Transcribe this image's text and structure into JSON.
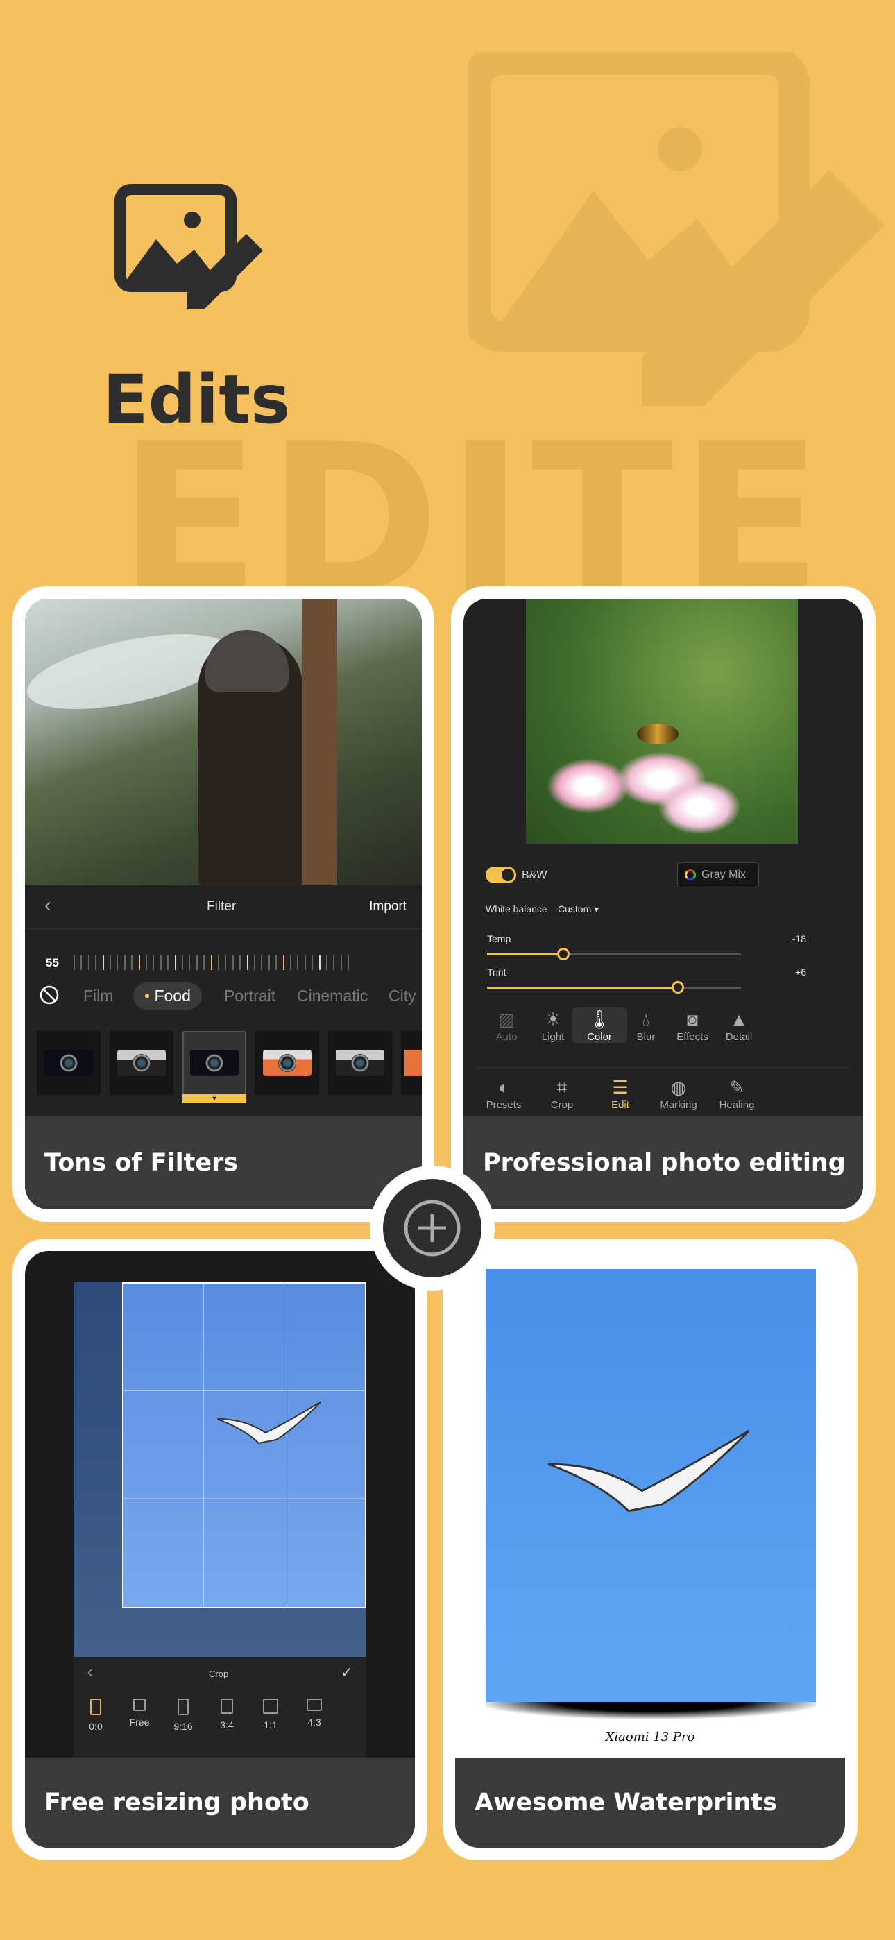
{
  "header": {
    "title": "Edits",
    "watermark_word": "EDITE",
    "icon": "image-edit-icon"
  },
  "colors": {
    "background": "#F5C15E",
    "accent": "#F3C14E",
    "card_caption": "#3a3a3a"
  },
  "cards": [
    {
      "caption": "Tons of Filters",
      "filter": {
        "back": "‹",
        "title": "Filter",
        "import": "Import",
        "value": "55",
        "categories": [
          "Film",
          "Food",
          "Portrait",
          "Cinematic",
          "City"
        ],
        "selected_category": "Food",
        "selected_thumb_index": 2
      }
    },
    {
      "caption": "Professional photo editing",
      "edit": {
        "bw_label": "B&W",
        "bw_on": true,
        "gray_mix": "Gray Mix",
        "white_balance": "White balance",
        "wb_mode": "Custom",
        "sliders": [
          {
            "label": "Temp",
            "value": "-18",
            "fraction": 0.3
          },
          {
            "label": "Trint",
            "value": "+6",
            "fraction": 0.75
          }
        ],
        "tools": [
          {
            "label": "Auto",
            "icon": "auto-image-icon"
          },
          {
            "label": "Light",
            "icon": "sun-icon"
          },
          {
            "label": "Color",
            "icon": "thermometer-icon"
          },
          {
            "label": "Blur",
            "icon": "drop-icon"
          },
          {
            "label": "Effects",
            "icon": "effects-icon"
          },
          {
            "label": "Detail",
            "icon": "triangle-icon"
          }
        ],
        "selected_tool": "Color",
        "tabs": [
          {
            "label": "Presets",
            "icon": "presets-icon"
          },
          {
            "label": "Crop",
            "icon": "crop-icon"
          },
          {
            "label": "Edit",
            "icon": "sliders-icon"
          },
          {
            "label": "Marking",
            "icon": "marking-icon"
          },
          {
            "label": "Healing",
            "icon": "bandage-icon"
          }
        ],
        "selected_tab": "Edit"
      }
    },
    {
      "caption": "Free resizing photo",
      "crop": {
        "back": "‹",
        "title": "Crop",
        "confirm": "✓",
        "ratios": [
          "0:0",
          "Free",
          "9:16",
          "3:4",
          "1:1",
          "4:3"
        ],
        "selected_ratio": "0:0"
      }
    },
    {
      "caption": "Awesome Waterprints",
      "watermark": {
        "text": "Xiaomi 13 Pro"
      }
    }
  ],
  "center_button": {
    "icon": "plus-circle-icon"
  }
}
